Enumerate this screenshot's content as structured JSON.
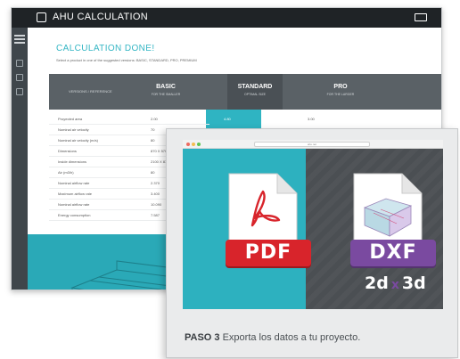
{
  "back_app": {
    "title": "AHU CALCULATION",
    "heading": "CALCULATION DONE!",
    "subtitle": "Select a product in one of the suggested versions: BASIC, STANDARD, PRO, PREMIUM",
    "table": {
      "label_col": "VERSIONS / REFERENCE",
      "columns": [
        {
          "name": "BASIC",
          "note": "FOR THE SMALLER"
        },
        {
          "name": "STANDARD",
          "note": "OPTIMAL SIZE"
        },
        {
          "name": "PRO",
          "note": "FOR THE LARGER"
        }
      ],
      "rows": [
        {
          "label": "Proyected area",
          "values": [
            "2.00",
            "4.80",
            "3.00"
          ]
        },
        {
          "label": "Nominal air velocity",
          "values": [
            "70",
            "70",
            "70"
          ]
        },
        {
          "label": "Nominal air velocity (m/s)",
          "values": [
            "80",
            "",
            ""
          ]
        },
        {
          "label": "Dimensions",
          "values": [
            "870 X 570 X 1100",
            "",
            ""
          ]
        },
        {
          "label": "Inside dimensions",
          "values": [
            "2100 X 870 X 1200",
            "",
            ""
          ]
        },
        {
          "label": "Air (m3/h)",
          "values": [
            "80",
            "",
            ""
          ]
        },
        {
          "label": "Nominal airflow rate",
          "values": [
            "2.370",
            "",
            ""
          ]
        },
        {
          "label": "Maximum airflow rate",
          "values": [
            "3.400",
            "",
            ""
          ]
        },
        {
          "label": "Nominal airflow rate",
          "values": [
            "10.090",
            "",
            ""
          ]
        },
        {
          "label": "Energy consumption",
          "values": [
            "7.587",
            "",
            ""
          ]
        }
      ]
    }
  },
  "export_window": {
    "address": "ahu.net",
    "pdf_label": "PDF",
    "dxf_label": "DXF",
    "dims_2d": "2d",
    "dims_sep": "x",
    "dims_3d": "3d",
    "caption_step": "PASO 3",
    "caption_text": "Exporta los datos a tu proyecto."
  },
  "colors": {
    "accent_teal": "#2fb4c2",
    "pdf_red": "#d8242b",
    "dxf_purple": "#7a4aa0",
    "dark_panel": "#4b4f53"
  },
  "icons": [
    "app-logo-icon",
    "window-control-icon",
    "menu-icon",
    "pdf-document-icon",
    "cad-document-icon"
  ]
}
